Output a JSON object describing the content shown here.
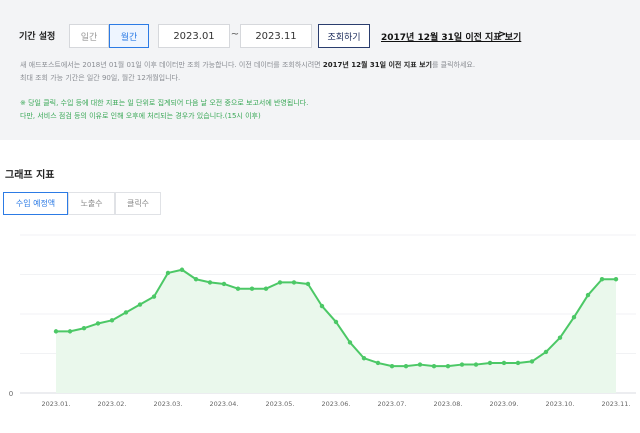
{
  "filter": {
    "period_label": "기간 설정",
    "daily_label": "일간",
    "monthly_label": "월간",
    "start_date": "2023.01",
    "range_separator": "~",
    "end_date": "2023.11",
    "search_button": "조회하기",
    "prev_data_link": "2017년 12월 31일 이전 지표 보기",
    "prev_data_arrow": ">",
    "notice_line1_a": "새 애드포스트에서는 2018년 01월 01일 이후 데이터만 조회 가능합니다. 이전 데이터를 조회하시려면 ",
    "notice_line1_b": "2017년 12월 31일 이전 지표 보기",
    "notice_line1_c": "를 클릭하세요.",
    "notice_line2": "최대 조회 가능 기간은 일간 90일, 월간 12개월입니다.",
    "green_line1": "※ 당일 클릭, 수입 등에 대한 지표는 일 단위로 집계되어 다음 날 오전 중으로 보고서에 반영됩니다.",
    "green_line2": "다만, 서비스 점검 등의 이유로 인해 오후에 처리되는 경우가 있습니다.(15시 이후)"
  },
  "graph": {
    "section_title": "그래프 지표",
    "tabs": [
      "수입 예정액",
      "노출수",
      "클릭수"
    ],
    "active_tab": 0
  },
  "colors": {
    "accent": "#2c7be5",
    "line": "#4cc866",
    "area": "#eaf8ec",
    "notice_green": "#3aa857"
  },
  "chart_data": {
    "type": "area",
    "title": "",
    "xlabel": "",
    "ylabel": "",
    "y_tick_labels": [
      "0"
    ],
    "ylim": [
      0,
      100
    ],
    "grid": true,
    "categories": [
      "2023.01.",
      "2023.02.",
      "2023.03.",
      "2023.04.",
      "2023.05.",
      "2023.06.",
      "2023.07.",
      "2023.08.",
      "2023.09.",
      "2023.10.",
      "2023.11."
    ],
    "x": [
      0.0,
      0.25,
      0.5,
      0.75,
      1.0,
      1.25,
      1.5,
      1.75,
      2.0,
      2.25,
      2.5,
      2.75,
      3.0,
      3.25,
      3.5,
      3.75,
      4.0,
      4.25,
      4.5,
      4.75,
      5.0,
      5.25,
      5.5,
      5.75,
      6.0,
      6.25,
      6.5,
      6.75,
      7.0,
      7.25,
      7.5,
      7.75,
      8.0,
      8.25,
      8.5,
      8.75,
      9.0,
      9.25,
      9.5,
      9.75,
      10.0
    ],
    "series": [
      {
        "values": [
          39,
          39,
          41,
          44,
          46,
          51,
          56,
          61,
          76,
          78,
          72,
          70,
          69,
          66,
          66,
          66,
          70,
          70,
          69,
          55,
          45,
          32,
          22,
          19,
          17,
          17,
          18,
          17,
          17,
          18,
          18,
          19,
          19,
          19,
          20,
          26,
          35,
          48,
          62,
          72,
          72
        ]
      }
    ]
  }
}
